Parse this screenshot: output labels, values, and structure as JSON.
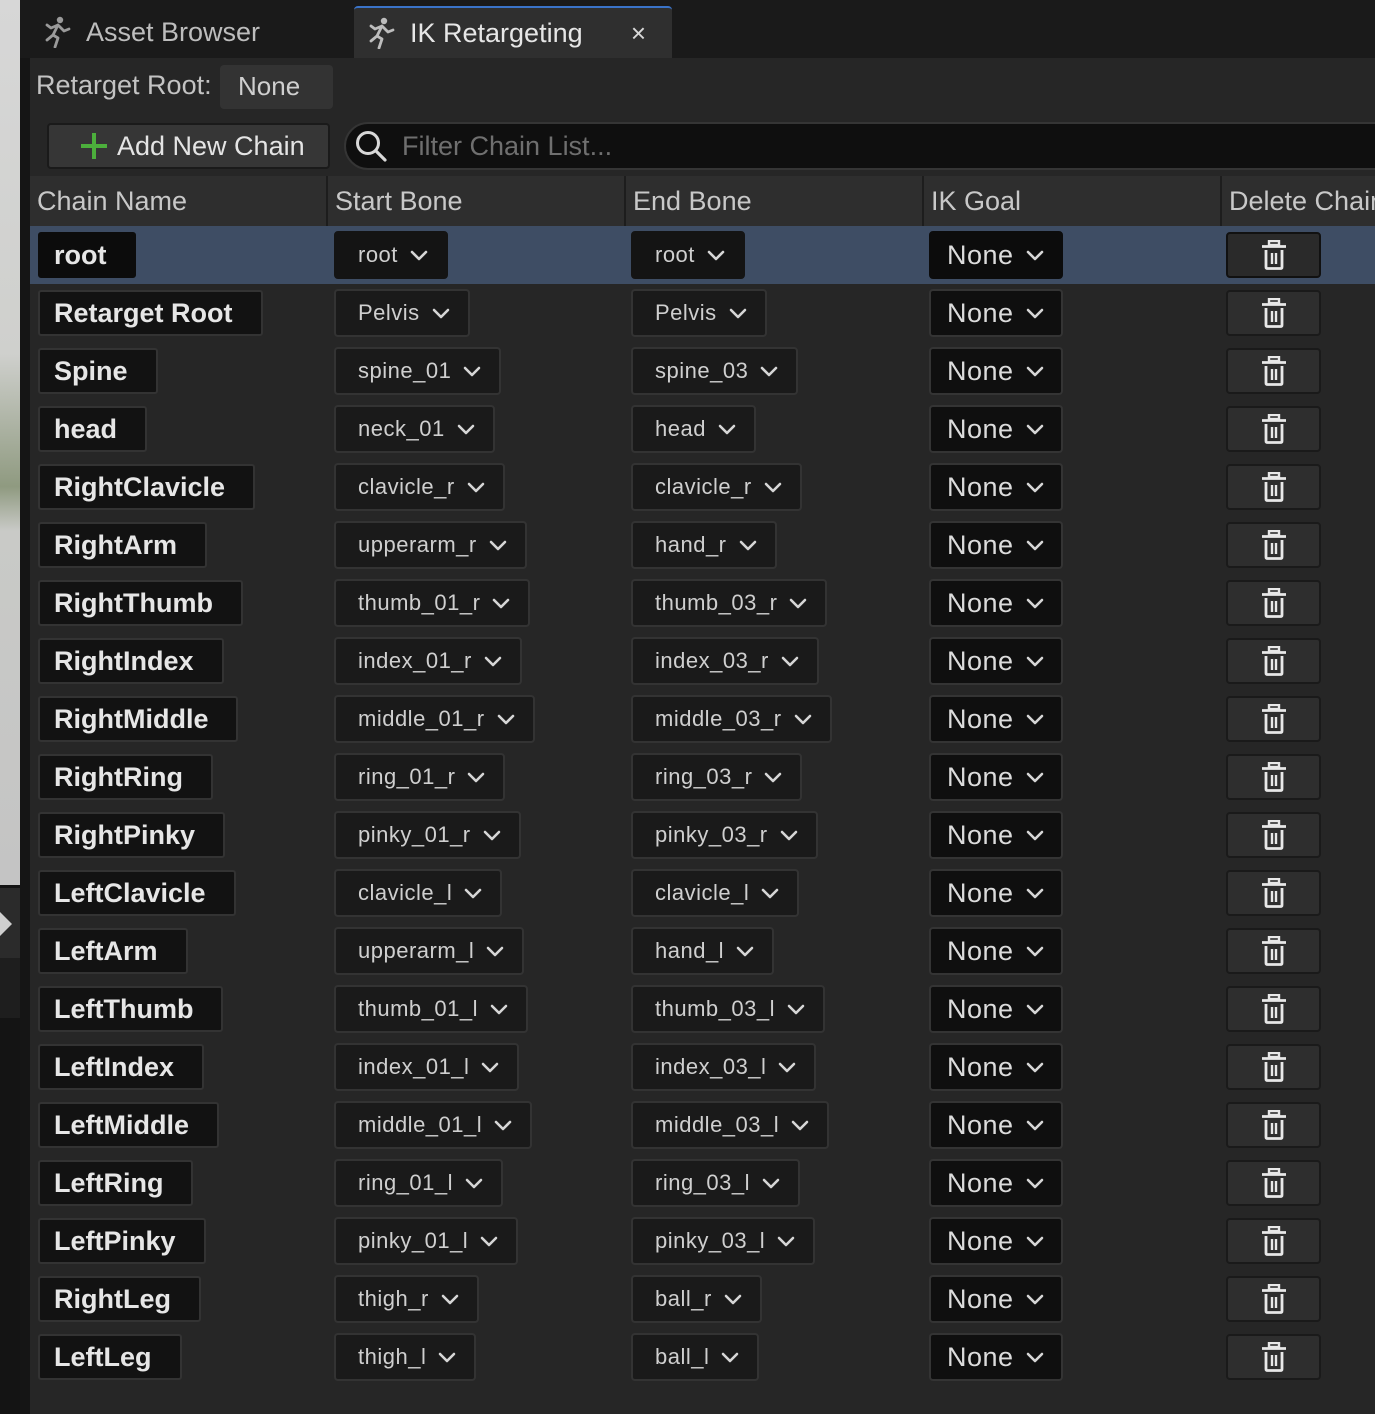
{
  "tabs": [
    {
      "label": "Asset Browser",
      "icon": "running-figure-icon",
      "active": false
    },
    {
      "label": "IK Retargeting",
      "icon": "running-figure-icon",
      "active": true,
      "close": "×"
    }
  ],
  "retarget_root": {
    "label": "Retarget Root:",
    "value": "None"
  },
  "toolbar": {
    "add_chain_label": "Add New Chain",
    "filter_placeholder": "Filter Chain List..."
  },
  "columns": [
    "Chain Name",
    "Start Bone",
    "End Bone",
    "IK Goal",
    "Delete Chain"
  ],
  "chains": [
    {
      "name": "root",
      "start": "root",
      "end": "root",
      "goal": "None",
      "selected": true
    },
    {
      "name": "Retarget Root",
      "start": "Pelvis",
      "end": "Pelvis",
      "goal": "None"
    },
    {
      "name": "Spine",
      "start": "spine_01",
      "end": "spine_03",
      "goal": "None"
    },
    {
      "name": "head",
      "start": "neck_01",
      "end": "head",
      "goal": "None"
    },
    {
      "name": "RightClavicle",
      "start": "clavicle_r",
      "end": "clavicle_r",
      "goal": "None"
    },
    {
      "name": "RightArm",
      "start": "upperarm_r",
      "end": "hand_r",
      "goal": "None"
    },
    {
      "name": "RightThumb",
      "start": "thumb_01_r",
      "end": "thumb_03_r",
      "goal": "None"
    },
    {
      "name": "RightIndex",
      "start": "index_01_r",
      "end": "index_03_r",
      "goal": "None"
    },
    {
      "name": "RightMiddle",
      "start": "middle_01_r",
      "end": "middle_03_r",
      "goal": "None"
    },
    {
      "name": "RightRing",
      "start": "ring_01_r",
      "end": "ring_03_r",
      "goal": "None"
    },
    {
      "name": "RightPinky",
      "start": "pinky_01_r",
      "end": "pinky_03_r",
      "goal": "None"
    },
    {
      "name": "LeftClavicle",
      "start": "clavicle_l",
      "end": "clavicle_l",
      "goal": "None"
    },
    {
      "name": "LeftArm",
      "start": "upperarm_l",
      "end": "hand_l",
      "goal": "None"
    },
    {
      "name": "LeftThumb",
      "start": "thumb_01_l",
      "end": "thumb_03_l",
      "goal": "None"
    },
    {
      "name": "LeftIndex",
      "start": "index_01_l",
      "end": "index_03_l",
      "goal": "None"
    },
    {
      "name": "LeftMiddle",
      "start": "middle_01_l",
      "end": "middle_03_l",
      "goal": "None"
    },
    {
      "name": "LeftRing",
      "start": "ring_01_l",
      "end": "ring_03_l",
      "goal": "None"
    },
    {
      "name": "LeftPinky",
      "start": "pinky_01_l",
      "end": "pinky_03_l",
      "goal": "None"
    },
    {
      "name": "RightLeg",
      "start": "thigh_r",
      "end": "ball_r",
      "goal": "None"
    },
    {
      "name": "LeftLeg",
      "start": "thigh_l",
      "end": "ball_l",
      "goal": "None"
    }
  ],
  "colors": {
    "accent": "#3a73c8",
    "selected_row": "#3e4d64",
    "add_icon": "#4caf3c"
  }
}
